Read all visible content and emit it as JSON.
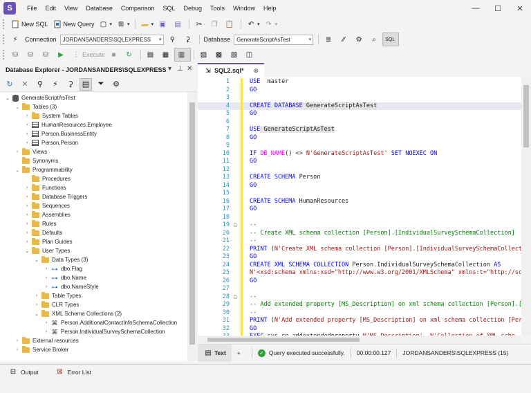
{
  "app": {
    "logo_letter": "S",
    "menu": [
      "File",
      "Edit",
      "View",
      "Database",
      "Comparison",
      "SQL",
      "Debug",
      "Tools",
      "Window",
      "Help"
    ],
    "window_controls": [
      "—",
      "☐",
      "✕"
    ]
  },
  "toolbar1": {
    "new_sql": "New SQL",
    "new_query": "New Query"
  },
  "toolbar2": {
    "connection_label": "Connection",
    "connection_value": "JORDANSANDERS\\SQLEXPRESS",
    "database_label": "Database",
    "database_value": "GenerateScriptAsTest",
    "sql_label": "SQL"
  },
  "toolbar3": {
    "execute_label": "Execute"
  },
  "explorer": {
    "title": "Database Explorer - JORDANSANDERS\\SQLEXPRESS",
    "tree": [
      {
        "label": "GenerateScriptAsTest",
        "level": 0,
        "exp": "⌄",
        "icon": "db"
      },
      {
        "label": "Tables (3)",
        "level": 1,
        "exp": "⌄",
        "icon": "folder"
      },
      {
        "label": "System Tables",
        "level": 2,
        "exp": "›",
        "icon": "folder"
      },
      {
        "label": "HumanResources.Employee",
        "level": 2,
        "exp": "›",
        "icon": "table"
      },
      {
        "label": "Person.BusinessEntity",
        "level": 2,
        "exp": "›",
        "icon": "table"
      },
      {
        "label": "Person.Person",
        "level": 2,
        "exp": "›",
        "icon": "table"
      },
      {
        "label": "Views",
        "level": 1,
        "exp": "›",
        "icon": "folder"
      },
      {
        "label": "Synonyms",
        "level": 1,
        "exp": "",
        "icon": "folder"
      },
      {
        "label": "Programmability",
        "level": 1,
        "exp": "⌄",
        "icon": "folder"
      },
      {
        "label": "Procedures",
        "level": 2,
        "exp": "",
        "icon": "folder"
      },
      {
        "label": "Functions",
        "level": 2,
        "exp": "›",
        "icon": "folder"
      },
      {
        "label": "Database Triggers",
        "level": 2,
        "exp": "›",
        "icon": "folder"
      },
      {
        "label": "Sequences",
        "level": 2,
        "exp": "›",
        "icon": "folder"
      },
      {
        "label": "Assemblies",
        "level": 2,
        "exp": "›",
        "icon": "folder"
      },
      {
        "label": "Rules",
        "level": 2,
        "exp": "›",
        "icon": "folder"
      },
      {
        "label": "Defaults",
        "level": 2,
        "exp": "›",
        "icon": "folder"
      },
      {
        "label": "Plan Guides",
        "level": 2,
        "exp": "›",
        "icon": "folder"
      },
      {
        "label": "User Types",
        "level": 2,
        "exp": "⌄",
        "icon": "folder"
      },
      {
        "label": "Data Types (3)",
        "level": 3,
        "exp": "⌄",
        "icon": "folder"
      },
      {
        "label": "dbo.Flag",
        "level": 4,
        "exp": "›",
        "icon": "type"
      },
      {
        "label": "dbo.Name",
        "level": 4,
        "exp": "›",
        "icon": "type"
      },
      {
        "label": "dbo.NameStyle",
        "level": 4,
        "exp": "›",
        "icon": "type"
      },
      {
        "label": "Table Types",
        "level": 3,
        "exp": "›",
        "icon": "folder"
      },
      {
        "label": "CLR Types",
        "level": 3,
        "exp": "›",
        "icon": "folder"
      },
      {
        "label": "XML Schema Collections (2)",
        "level": 3,
        "exp": "⌄",
        "icon": "folder"
      },
      {
        "label": "Person.AdditionalContactInfoSchemaCollection",
        "level": 4,
        "exp": "›",
        "icon": "xml"
      },
      {
        "label": "Person.IndividualSurveySchemaCollection",
        "level": 4,
        "exp": "›",
        "icon": "xml"
      },
      {
        "label": "External resources",
        "level": 1,
        "exp": "›",
        "icon": "folder"
      },
      {
        "label": "Service Broker",
        "level": 1,
        "exp": "›",
        "icon": "folder"
      }
    ]
  },
  "editor": {
    "tab_title": "SQL2.sql*",
    "lines": [
      [
        [
          "kw",
          "USE"
        ],
        [
          "",
          "  master"
        ]
      ],
      [
        [
          "kw",
          "GO"
        ]
      ],
      [],
      [
        [
          "kw",
          "CREATE DATABASE"
        ],
        [
          "hl",
          " GenerateScriptAsTest"
        ]
      ],
      [
        [
          "kw",
          "GO"
        ]
      ],
      [],
      [
        [
          "kw",
          "USE"
        ],
        [
          "hl",
          " GenerateScriptAsTest"
        ]
      ],
      [
        [
          "kw",
          "GO"
        ]
      ],
      [],
      [
        [
          "kw",
          "IF"
        ],
        [
          "fn",
          " DB_NAME"
        ],
        [
          "",
          "() <> "
        ],
        [
          "str",
          "N'GenerateScriptAsTest'"
        ],
        [
          "kw",
          " SET NOEXEC ON"
        ]
      ],
      [
        [
          "kw",
          "GO"
        ]
      ],
      [],
      [
        [
          "kw",
          "CREATE SCHEMA"
        ],
        [
          "",
          " Person"
        ]
      ],
      [
        [
          "kw",
          "GO"
        ]
      ],
      [],
      [
        [
          "kw",
          "CREATE SCHEMA"
        ],
        [
          "",
          " HumanResources"
        ]
      ],
      [
        [
          "kw",
          "GO"
        ]
      ],
      [],
      [
        [
          "cmt",
          "--"
        ]
      ],
      [
        [
          "cmt",
          "-- Create XML schema collection [Person].[IndividualSurveySchemaCollection]"
        ]
      ],
      [
        [
          "cmt",
          "--"
        ]
      ],
      [
        [
          "kw",
          "PRINT"
        ],
        [
          "",
          " ("
        ],
        [
          "str",
          "N'Create XML schema collection [Person].[IndividualSurveySchemaCollection]'"
        ],
        [
          "",
          ")"
        ]
      ],
      [
        [
          "kw",
          "GO"
        ]
      ],
      [
        [
          "kw",
          "CREATE XML SCHEMA COLLECTION"
        ],
        [
          "",
          " Person.IndividualSurveySchemaCollection "
        ],
        [
          "kw",
          "AS"
        ]
      ],
      [
        [
          "str",
          "N'<xsd:schema xmlns:xsd=\"http://www.w3.org/2001/XMLSchema\" xmlns:t=\"http://schemas"
        ]
      ],
      [
        [
          "kw",
          "GO"
        ]
      ],
      [],
      [
        [
          "cmt",
          "--"
        ]
      ],
      [
        [
          "cmt",
          "-- Add extended property [MS_Description] on xml schema collection [Person].[Individu"
        ]
      ],
      [
        [
          "cmt",
          "--"
        ]
      ],
      [
        [
          "kw",
          "PRINT"
        ],
        [
          "",
          " ("
        ],
        [
          "str",
          "N'Add extended property [MS_Description] on xml schema collection [Person]."
        ]
      ],
      [
        [
          "kw",
          "GO"
        ]
      ],
      [
        [
          "kw",
          "EXEC"
        ],
        [
          "",
          " sys.sp_addextendedproperty "
        ],
        [
          "str",
          "N'MS_Description'"
        ],
        [
          "",
          ", "
        ],
        [
          "str",
          "N'Collection of XML sche"
        ]
      ]
    ]
  },
  "status": {
    "text_tab": "Text",
    "add_tab": "+",
    "message": "Query executed successfully.",
    "elapsed": "00:00:00.127",
    "connection": "JORDANSANDERS\\SQLEXPRESS (15)"
  },
  "bottom": {
    "output": "Output",
    "error_list": "Error List"
  }
}
